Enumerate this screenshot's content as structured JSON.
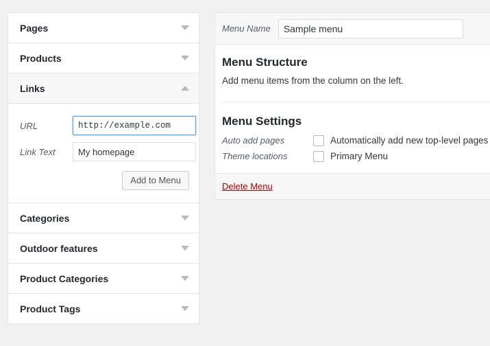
{
  "left_column": {
    "panels": [
      {
        "title": "Pages",
        "icon": "chevron-down-icon",
        "open": false
      },
      {
        "title": "Products",
        "icon": "chevron-down-icon",
        "open": false
      },
      {
        "title": "Links",
        "icon": "chevron-up-icon",
        "open": true
      },
      {
        "title": "Categories",
        "icon": "chevron-down-icon",
        "open": false
      },
      {
        "title": "Outdoor features",
        "icon": "chevron-down-icon",
        "open": false
      },
      {
        "title": "Product Categories",
        "icon": "chevron-down-icon",
        "open": false
      },
      {
        "title": "Product Tags",
        "icon": "chevron-down-icon",
        "open": false
      }
    ],
    "links_panel": {
      "url_label": "URL",
      "url_value": "http://example.com",
      "link_text_label": "Link Text",
      "link_text_value": "My homepage",
      "add_button_label": "Add to Menu"
    }
  },
  "right_column": {
    "menu_name_label": "Menu Name",
    "menu_name_value": "Sample menu",
    "structure_heading": "Menu Structure",
    "structure_description": "Add menu items from the column on the left.",
    "settings_heading": "Menu Settings",
    "settings": [
      {
        "label": "Auto add pages",
        "checkbox_text": "Automatically add new top-level pages to",
        "checked": false
      },
      {
        "label": "Theme locations",
        "checkbox_text": "Primary Menu",
        "checked": false
      }
    ],
    "delete_label": "Delete Menu"
  },
  "colors": {
    "page_background": "#f1f1f1",
    "panel_background": "#ffffff",
    "panel_border": "#e5e5e5",
    "header_bar": "#f7f7f7",
    "heading_text": "#23282d",
    "muted_label": "#555d66",
    "focus_blue": "#5b9dd9",
    "delete_red": "#a00000",
    "arrow_gray": "#b4b9be"
  }
}
